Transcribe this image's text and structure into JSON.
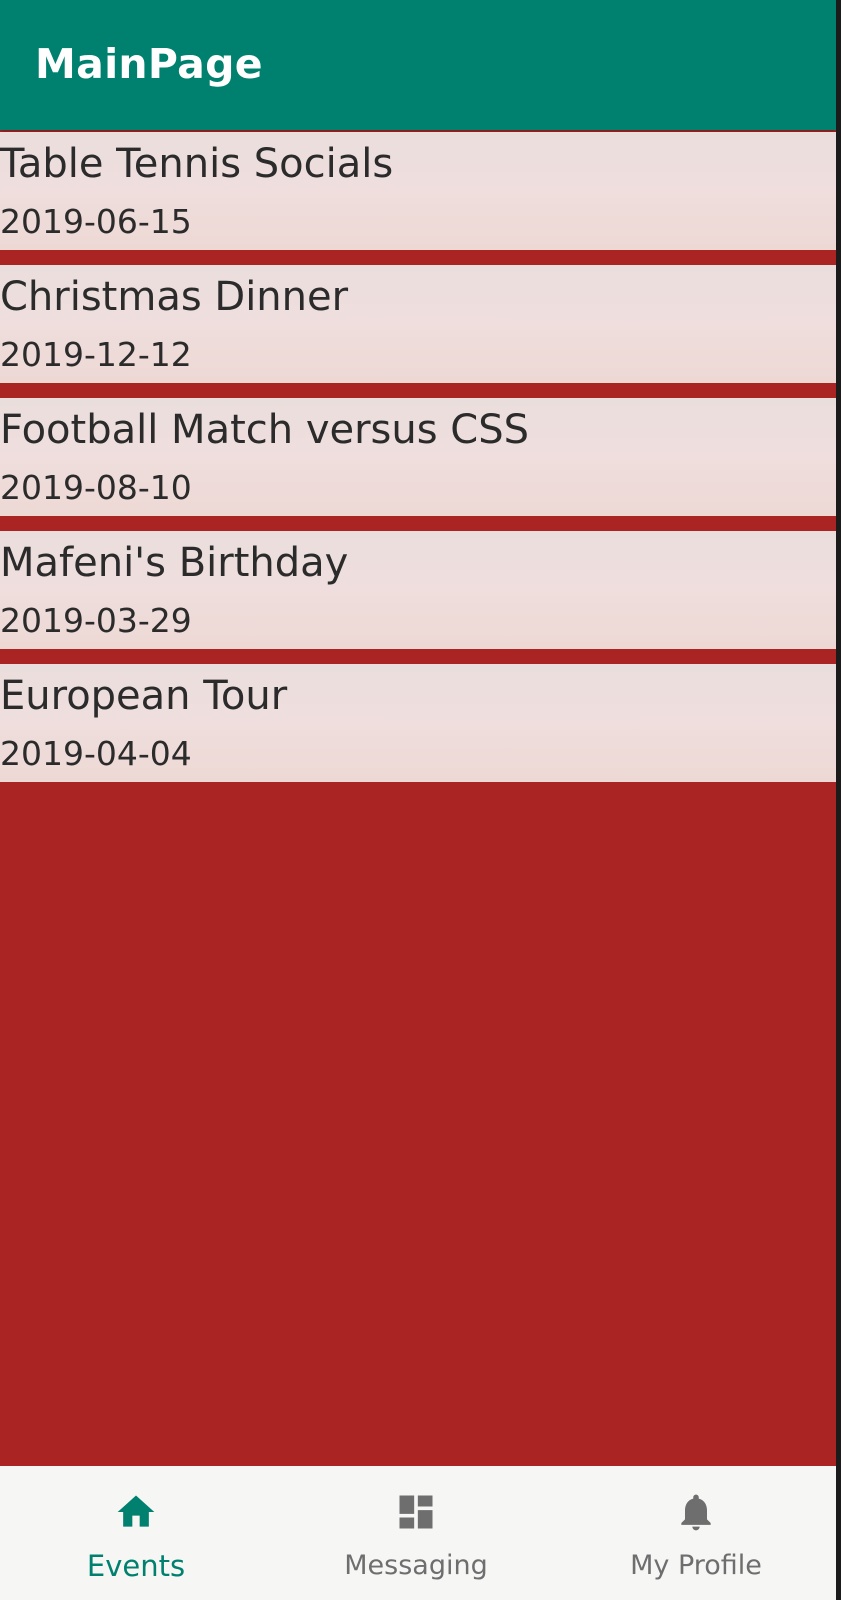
{
  "app_bar": {
    "title": "MainPage",
    "color": "#00806f"
  },
  "background_color": "#ab2424",
  "events": [
    {
      "name": "Table Tennis Socials",
      "date": "2019-06-15"
    },
    {
      "name": "Christmas Dinner",
      "date": "2019-12-12"
    },
    {
      "name": "Football Match versus CSS",
      "date": "2019-08-10"
    },
    {
      "name": "Mafeni's Birthday",
      "date": "2019-03-29"
    },
    {
      "name": "European Tour",
      "date": "2019-04-04"
    }
  ],
  "bottom_nav": {
    "items": [
      {
        "label": "Events",
        "icon": "home-icon",
        "active": true
      },
      {
        "label": "Messaging",
        "icon": "dashboard-icon",
        "active": false
      },
      {
        "label": "My Profile",
        "icon": "bell-icon",
        "active": false
      }
    ],
    "active_color": "#00806f",
    "inactive_color": "#6e6e6e"
  }
}
